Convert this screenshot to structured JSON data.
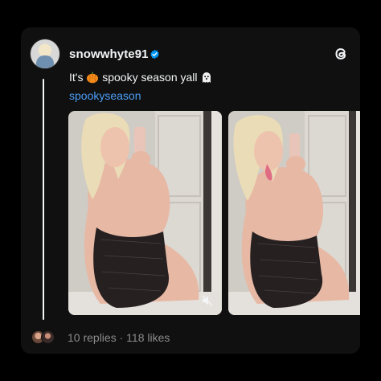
{
  "post": {
    "username": "snowwhyte91",
    "text_before": "It's ",
    "text_middle": " spooky season yall ",
    "hashtag": "spookyseason",
    "replies_label": "10 replies",
    "separator": " · ",
    "likes_label": "118 likes"
  },
  "icons": {
    "verified": "verified-badge-icon",
    "logo": "threads-logo-icon",
    "mute": "mute-icon",
    "emoji_1": "pumpkin-emoji",
    "emoji_2": "ghost-emoji"
  },
  "colors": {
    "background": "#000000",
    "card": "#101010",
    "text": "#f3f5f7",
    "hashtag": "#4a9df5",
    "muted": "#8b8b8b",
    "verified": "#0095f6"
  }
}
